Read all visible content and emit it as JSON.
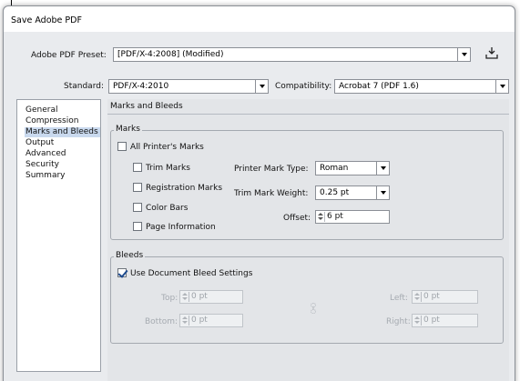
{
  "window": {
    "title": "Save Adobe PDF"
  },
  "preset": {
    "label": "Adobe PDF Preset:",
    "value": "[PDF/X-4:2008] (Modified)"
  },
  "standard": {
    "label": "Standard:",
    "value": "PDF/X-4:2010"
  },
  "compatibility": {
    "label": "Compatibility:",
    "value": "Acrobat 7 (PDF 1.6)"
  },
  "sidebar": {
    "items": [
      {
        "label": "General"
      },
      {
        "label": "Compression"
      },
      {
        "label": "Marks and Bleeds",
        "selected": true
      },
      {
        "label": "Output"
      },
      {
        "label": "Advanced"
      },
      {
        "label": "Security"
      },
      {
        "label": "Summary"
      }
    ]
  },
  "panel": {
    "title": "Marks and Bleeds"
  },
  "marks": {
    "group_label": "Marks",
    "all_printers_marks": {
      "label": "All Printer's Marks",
      "checked": false
    },
    "trim_marks": {
      "label": "Trim Marks",
      "checked": false
    },
    "registration_marks": {
      "label": "Registration Marks",
      "checked": false
    },
    "color_bars": {
      "label": "Color Bars",
      "checked": false
    },
    "page_information": {
      "label": "Page Information",
      "checked": false
    },
    "printer_mark_type": {
      "label": "Printer Mark Type:",
      "value": "Roman"
    },
    "trim_mark_weight": {
      "label": "Trim Mark Weight:",
      "value": "0.25 pt"
    },
    "offset": {
      "label": "Offset:",
      "value": "6 pt"
    }
  },
  "bleeds": {
    "group_label": "Bleeds",
    "use_document_bleed": {
      "label": "Use Document Bleed Settings",
      "checked": true
    },
    "top": {
      "label": "Top:",
      "value": "0 pt"
    },
    "bottom": {
      "label": "Bottom:",
      "value": "0 pt"
    },
    "left": {
      "label": "Left:",
      "value": "0 pt"
    },
    "right": {
      "label": "Right:",
      "value": "0 pt"
    }
  },
  "icons": {
    "save_preset": "save-preset-icon",
    "link": "chain-link-icon"
  }
}
